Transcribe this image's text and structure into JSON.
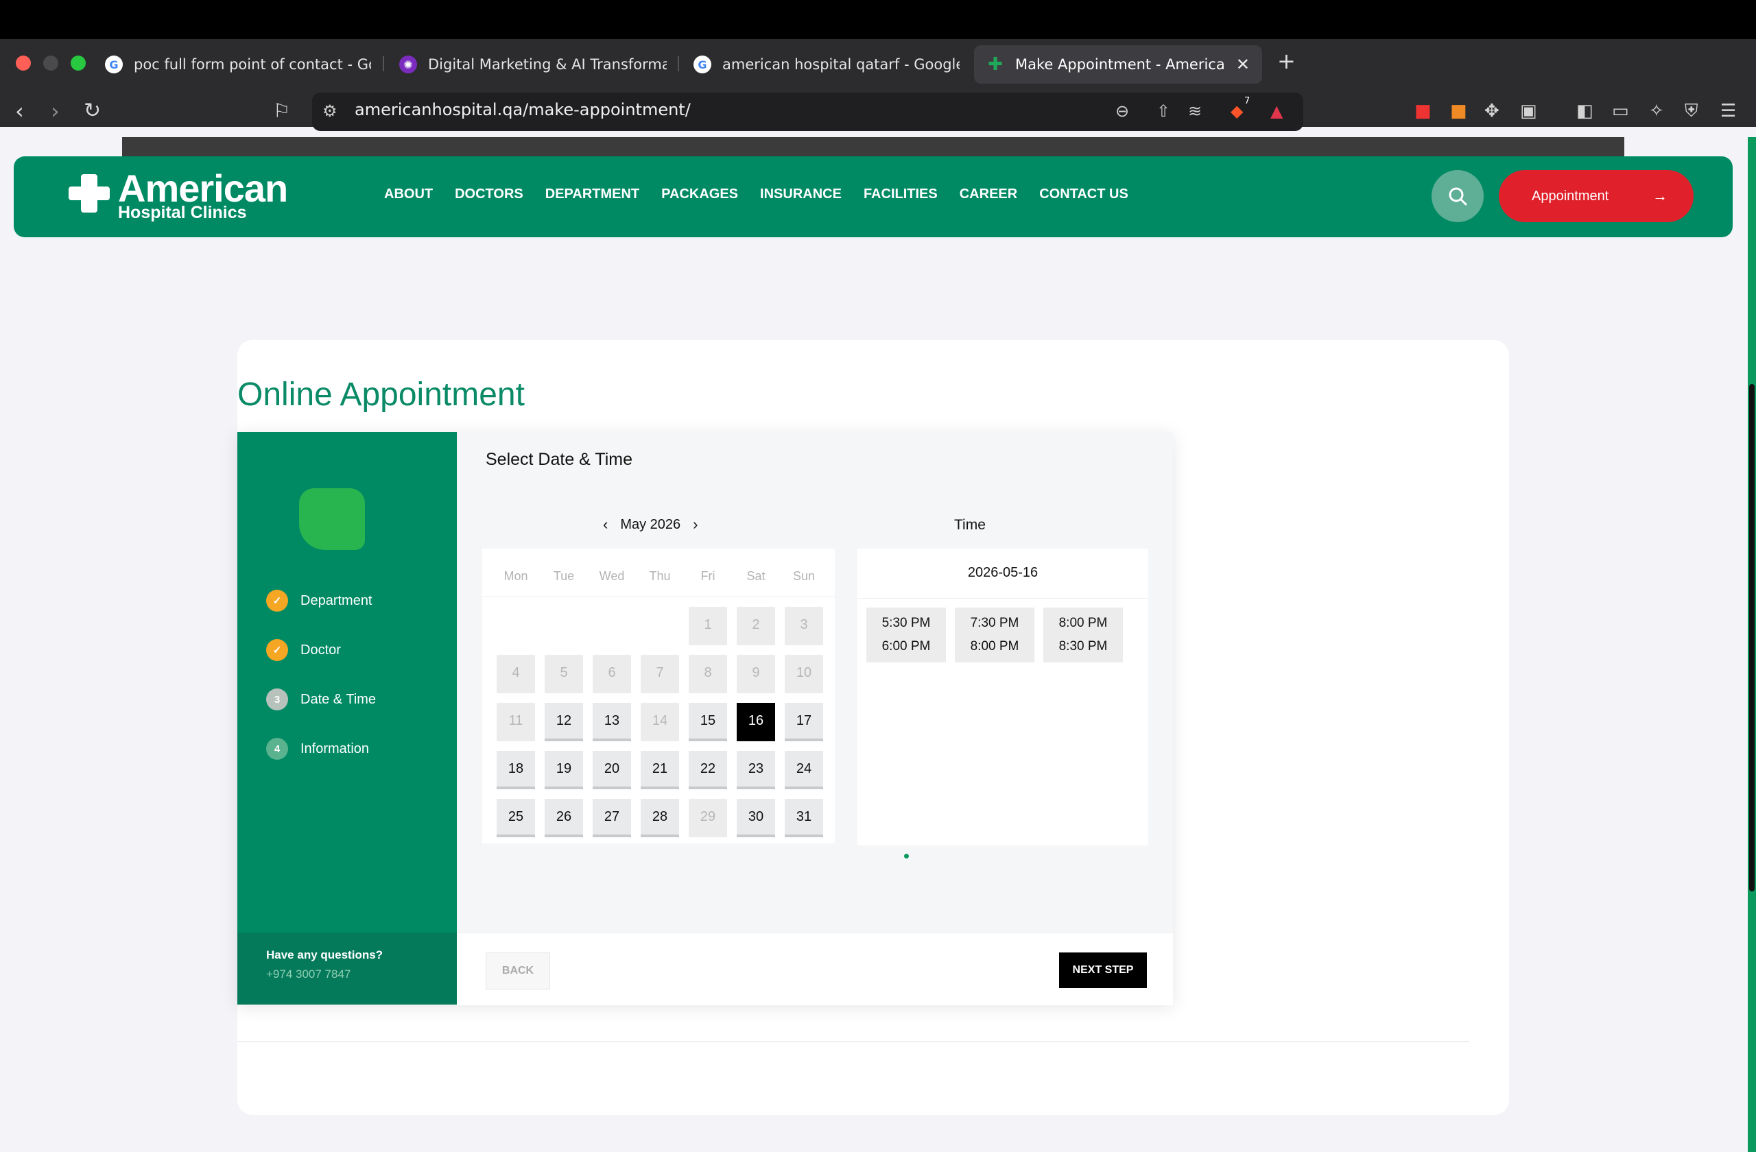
{
  "browser": {
    "tabs": [
      {
        "title": "poc full form point of contact - Goo",
        "active": false
      },
      {
        "title": "Digital Marketing & AI Transformati",
        "active": false
      },
      {
        "title": "american hospital qatarf - Google S",
        "active": false
      },
      {
        "title": "Make Appointment - American",
        "active": true
      }
    ],
    "url": "americanhospital.qa/make-appointment/",
    "brave_badge": "7"
  },
  "header": {
    "logo_main": "American",
    "logo_sub": "Hospital Clinics",
    "nav": [
      "ABOUT",
      "DOCTORS",
      "DEPARTMENT",
      "PACKAGES",
      "INSURANCE",
      "FACILITIES",
      "CAREER",
      "CONTACT US"
    ],
    "appointment_label": "Appointment",
    "appointment_arrow": "→"
  },
  "page": {
    "title": "Online Appointment"
  },
  "wizard": {
    "steps": [
      {
        "label": "Department",
        "state": "done",
        "marker": "✓"
      },
      {
        "label": "Doctor",
        "state": "done",
        "marker": "✓"
      },
      {
        "label": "Date & Time",
        "state": "current",
        "marker": "3"
      },
      {
        "label": "Information",
        "state": "todo",
        "marker": "4"
      }
    ],
    "questions_label": "Have any questions?",
    "phone": "+974 3007 7847",
    "panel_title": "Select Date & Time",
    "back_label": "BACK",
    "next_label": "NEXT STEP"
  },
  "calendar": {
    "prev": "‹",
    "next": "›",
    "month_label": "May 2026",
    "weekdays": [
      "Mon",
      "Tue",
      "Wed",
      "Thu",
      "Fri",
      "Sat",
      "Sun"
    ],
    "weeks": [
      [
        null,
        null,
        null,
        null,
        {
          "d": "1",
          "s": "disabled"
        },
        {
          "d": "2",
          "s": "disabled"
        },
        {
          "d": "3",
          "s": "disabled"
        }
      ],
      [
        {
          "d": "4",
          "s": "disabled"
        },
        {
          "d": "5",
          "s": "disabled"
        },
        {
          "d": "6",
          "s": "disabled"
        },
        {
          "d": "7",
          "s": "disabled"
        },
        {
          "d": "8",
          "s": "disabled"
        },
        {
          "d": "9",
          "s": "disabled"
        },
        {
          "d": "10",
          "s": "disabled"
        }
      ],
      [
        {
          "d": "11",
          "s": "disabled"
        },
        {
          "d": "12",
          "s": "available"
        },
        {
          "d": "13",
          "s": "available"
        },
        {
          "d": "14",
          "s": "disabled"
        },
        {
          "d": "15",
          "s": "available"
        },
        {
          "d": "16",
          "s": "selected"
        },
        {
          "d": "17",
          "s": "available"
        }
      ],
      [
        {
          "d": "18",
          "s": "available"
        },
        {
          "d": "19",
          "s": "available"
        },
        {
          "d": "20",
          "s": "available"
        },
        {
          "d": "21",
          "s": "available"
        },
        {
          "d": "22",
          "s": "available"
        },
        {
          "d": "23",
          "s": "available"
        },
        {
          "d": "24",
          "s": "available"
        }
      ],
      [
        {
          "d": "25",
          "s": "available"
        },
        {
          "d": "26",
          "s": "available"
        },
        {
          "d": "27",
          "s": "available"
        },
        {
          "d": "28",
          "s": "available"
        },
        {
          "d": "29",
          "s": "disabled"
        },
        {
          "d": "30",
          "s": "available"
        },
        {
          "d": "31",
          "s": "available"
        }
      ]
    ]
  },
  "time": {
    "label": "Time",
    "selected_date": "2026-05-16",
    "slots": [
      {
        "start": "5:30 PM",
        "end": "6:00 PM"
      },
      {
        "start": "7:30 PM",
        "end": "8:00 PM"
      },
      {
        "start": "8:00 PM",
        "end": "8:30 PM"
      }
    ]
  }
}
